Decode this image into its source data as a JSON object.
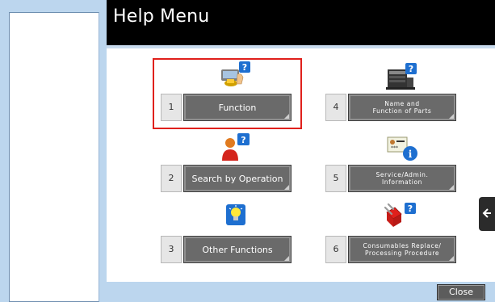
{
  "header": {
    "title": "Help Menu"
  },
  "menu": {
    "items": [
      {
        "number": "1",
        "label": "Function",
        "icon": "function-help-icon"
      },
      {
        "number": "2",
        "label": "Search by Operation",
        "icon": "search-operation-icon"
      },
      {
        "number": "3",
        "label": "Other Functions",
        "icon": "lightbulb-icon"
      },
      {
        "number": "4",
        "label": "Name and\nFunction of Parts",
        "icon": "printer-parts-icon"
      },
      {
        "number": "5",
        "label": "Service/Admin.\nInformation",
        "icon": "admin-info-icon"
      },
      {
        "number": "6",
        "label": "Consumables Replace/\nProcessing Procedure",
        "icon": "toolbox-icon"
      }
    ]
  },
  "footer": {
    "close_label": "Close"
  },
  "colors": {
    "highlight": "#e0201c",
    "title_bg": "#000000",
    "frame": "#bcd6ee",
    "button": "#6a6a6a"
  }
}
